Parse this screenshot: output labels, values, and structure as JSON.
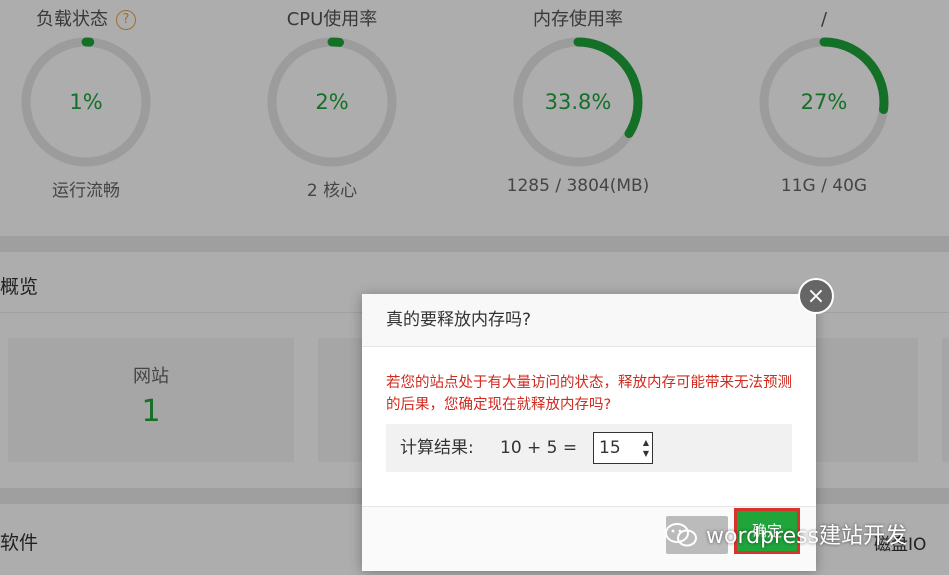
{
  "gauges": [
    {
      "title": "负载状态",
      "value": "1%",
      "percent": 1,
      "sub": "运行流畅",
      "help": "?"
    },
    {
      "title": "CPU使用率",
      "value": "2%",
      "percent": 2,
      "sub": "2 核心"
    },
    {
      "title": "内存使用率",
      "value": "33.8%",
      "percent": 33.8,
      "sub": "1285 / 3804(MB)"
    },
    {
      "title": "/",
      "value": "27%",
      "percent": 27,
      "sub": "11G / 40G"
    }
  ],
  "overview": {
    "title": "概览",
    "cards": [
      {
        "label": "网站",
        "value": "1"
      }
    ]
  },
  "software": {
    "title": "软件",
    "disk_label": "磁盘IO"
  },
  "dialog": {
    "title": "真的要释放内存吗?",
    "close": "×",
    "warning": "若您的站点处于有大量访问的状态，释放内存可能带来无法预测的后果，您确定现在就释放内存吗?",
    "calc_label": "计算结果:",
    "calc_expr": "10 + 5  =",
    "calc_value": "15",
    "confirm_label": "确定"
  },
  "watermark": "wordpress建站开发",
  "colors": {
    "accent": "#20a53a",
    "warning": "#d0291e",
    "ring_bg": "#e6e6e6",
    "highlight": "#d9342b"
  }
}
